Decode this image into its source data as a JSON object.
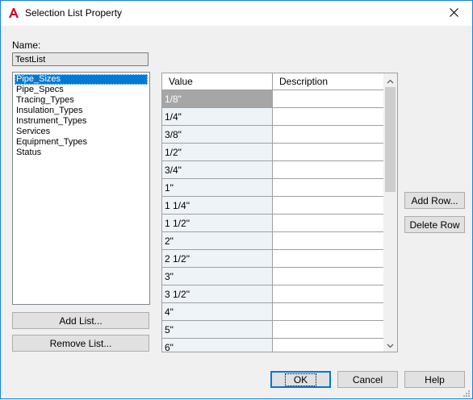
{
  "window": {
    "title": "Selection List Property"
  },
  "name_label": "Name:",
  "name_value": "TestList",
  "lists": [
    "Pipe_Sizes",
    "Pipe_Specs",
    "Tracing_Types",
    "Insulation_Types",
    "Instrument_Types",
    "Services",
    "Equipment_Types",
    "Status"
  ],
  "selected_list": "Pipe_Sizes",
  "buttons": {
    "add_list": "Add List...",
    "remove_list": "Remove List...",
    "add_row": "Add Row...",
    "delete_row": "Delete Row",
    "ok": "OK",
    "cancel": "Cancel",
    "help": "Help"
  },
  "grid": {
    "columns": [
      "Value",
      "Description"
    ],
    "rows": [
      {
        "value": "1/8\"",
        "description": ""
      },
      {
        "value": "1/4\"",
        "description": ""
      },
      {
        "value": "3/8\"",
        "description": ""
      },
      {
        "value": "1/2\"",
        "description": ""
      },
      {
        "value": "3/4\"",
        "description": ""
      },
      {
        "value": "1\"",
        "description": ""
      },
      {
        "value": "1 1/4\"",
        "description": ""
      },
      {
        "value": "1 1/2\"",
        "description": ""
      },
      {
        "value": "2\"",
        "description": ""
      },
      {
        "value": "2 1/2\"",
        "description": ""
      },
      {
        "value": "3\"",
        "description": ""
      },
      {
        "value": "3 1/2\"",
        "description": ""
      },
      {
        "value": "4\"",
        "description": ""
      },
      {
        "value": "5\"",
        "description": ""
      },
      {
        "value": "6\"",
        "description": ""
      }
    ],
    "selected_row": 0
  },
  "colors": {
    "accent": "#0078d7",
    "app_icon": "#c8102e"
  }
}
